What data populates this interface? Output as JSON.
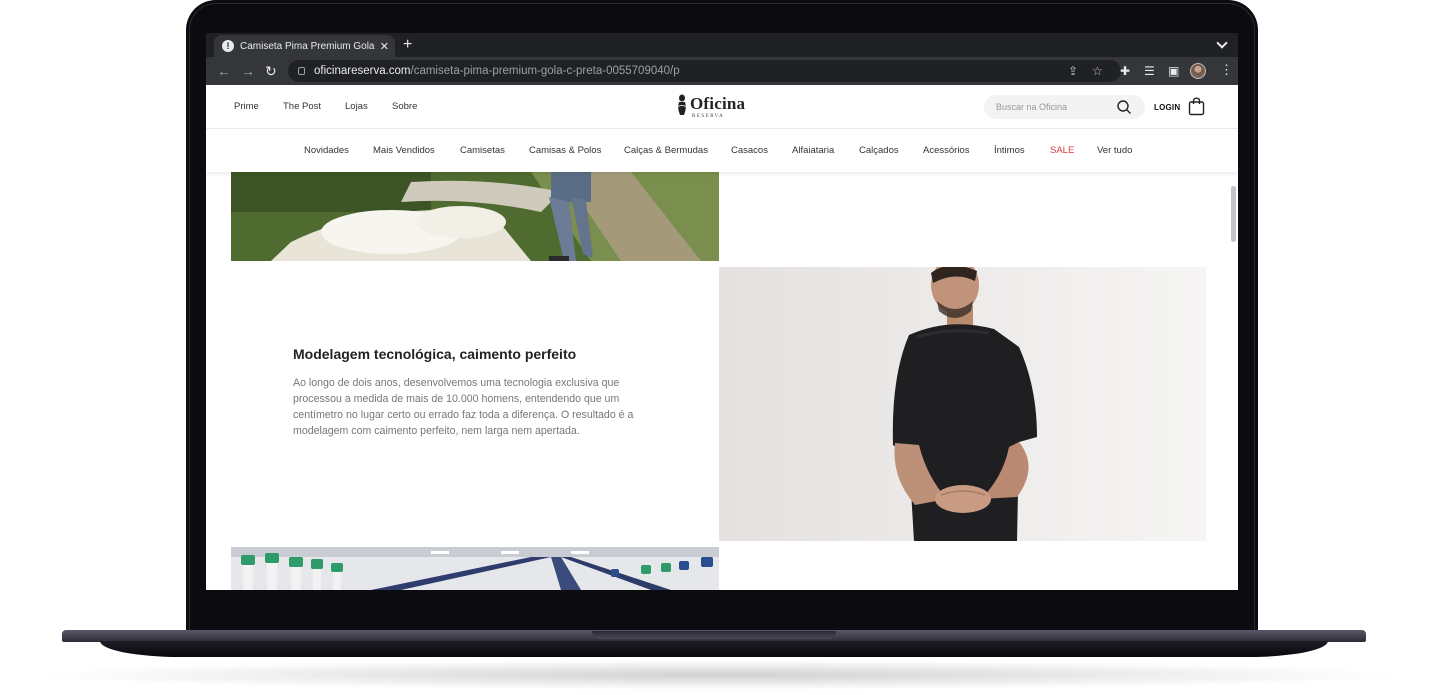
{
  "browser": {
    "tab_title": "Camiseta Pima Premium Gola C",
    "url_host": "oficinareserva.com",
    "url_path": "/camiseta-pima-premium-gola-c-preta-0055709040/p"
  },
  "header": {
    "top_links": [
      "Prime",
      "The Post",
      "Lojas",
      "Sobre"
    ],
    "logo_text": "Oficina",
    "logo_sub": "RESERVA",
    "search_placeholder": "Buscar na Oficina",
    "login_label": "LOGIN"
  },
  "categories": [
    "Novidades",
    "Mais Vendidos",
    "Camisetas",
    "Camisas & Polos",
    "Calças & Bermudas",
    "Casacos",
    "Alfaiataria",
    "Calçados",
    "Acessórios",
    "Íntimos",
    "SALE",
    "Ver tudo"
  ],
  "colors": {
    "sale": "#e23a3a",
    "text_muted": "#777777"
  },
  "feature": {
    "title": "Modelagem tecnológica, caimento perfeito",
    "text": "Ao longo de dois anos, desenvolvemos uma tecnologia exclusiva que processou a medida de mais de 10.000 homens, entendendo que um centímetro no lugar certo ou errado faz toda a diferença. O resultado é a modelagem com caimento perfeito, nem larga nem apertada."
  }
}
